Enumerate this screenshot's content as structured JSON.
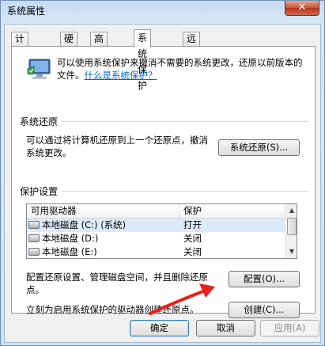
{
  "window": {
    "title": "系统属性",
    "close_glyph": "✕"
  },
  "tabs": [
    {
      "label": "计算机名",
      "active": false
    },
    {
      "label": "硬件",
      "active": false
    },
    {
      "label": "高级",
      "active": false
    },
    {
      "label": "系统保护",
      "active": true
    },
    {
      "label": "远程",
      "active": false
    }
  ],
  "intro": {
    "text": "可以使用系统保护来撤消不需要的系统更改，还原以前版本的文件。",
    "link": "什么是系统保护？",
    "icon": "computer-shield-icon"
  },
  "restore_group": {
    "title": "系统还原",
    "text": "可以通过将计算机还原到上一个还原点，撤消系统更改。",
    "button": "系统还原(S)..."
  },
  "protection_group": {
    "title": "保护设置",
    "columns": [
      "可用驱动器",
      "保护"
    ],
    "drives": [
      {
        "name": "本地磁盘 (C:) (系统)",
        "status": "打开",
        "selected": true
      },
      {
        "name": "本地磁盘 (D:)",
        "status": "关闭",
        "selected": false
      },
      {
        "name": "本地磁盘 (E:)",
        "status": "关闭",
        "selected": false
      }
    ],
    "config_text": "配置还原设置、管理磁盘空间，并且删除还原点。",
    "config_button": "配置(O)...",
    "create_text": "立刻为启用系统保护的驱动器创建还原点。",
    "create_button": "创建(C)..."
  },
  "footer": {
    "ok": "确定",
    "cancel": "取消",
    "apply": "应用(A)"
  },
  "colors": {
    "annotation_arrow": "#e8201c",
    "link": "#0066cc"
  }
}
